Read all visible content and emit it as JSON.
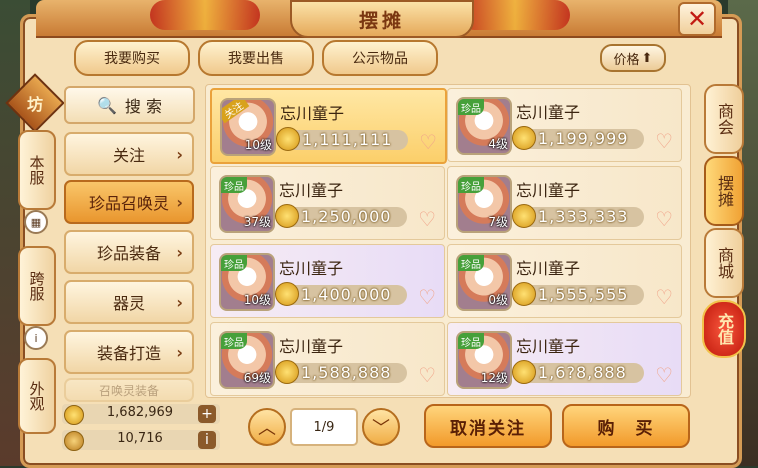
{
  "title": "摆摊",
  "top_tabs": [
    "我要购买",
    "我要出售",
    "公示物品"
  ],
  "sort_button": "价格",
  "side_emblem": "坊",
  "left_tabs": [
    "本服",
    "跨服",
    "外观"
  ],
  "search_label": "搜 索",
  "categories": [
    "关注",
    "珍品召唤灵",
    "珍品装备",
    "器灵",
    "装备打造",
    "召唤灵装备"
  ],
  "listings": [
    {
      "name": "忘川童子",
      "level": "10级",
      "price": "1,111,111",
      "tag": "关注"
    },
    {
      "name": "忘川童子",
      "level": "4级",
      "price": "1,199,999",
      "tag": "珍品"
    },
    {
      "name": "忘川童子",
      "level": "37级",
      "price": "1,250,000",
      "tag": "珍品"
    },
    {
      "name": "忘川童子",
      "level": "7级",
      "price": "1,333,333",
      "tag": "珍品"
    },
    {
      "name": "忘川童子",
      "level": "10级",
      "price": "1,400,000",
      "tag": "珍品"
    },
    {
      "name": "忘川童子",
      "level": "0级",
      "price": "1,555,555",
      "tag": "珍品"
    },
    {
      "name": "忘川童子",
      "level": "69级",
      "price": "1,588,888",
      "tag": "珍品"
    },
    {
      "name": "忘川童子",
      "level": "12级",
      "price": "1,6?8,888",
      "tag": "珍品"
    }
  ],
  "right_tabs": [
    "商会",
    "摆摊",
    "商城"
  ],
  "recharge": "充值",
  "currency": {
    "gold": "1,682,969",
    "silver": "10,716"
  },
  "page": "1/9",
  "unfollow_btn": "取消关注",
  "buy_btn": "购　买"
}
